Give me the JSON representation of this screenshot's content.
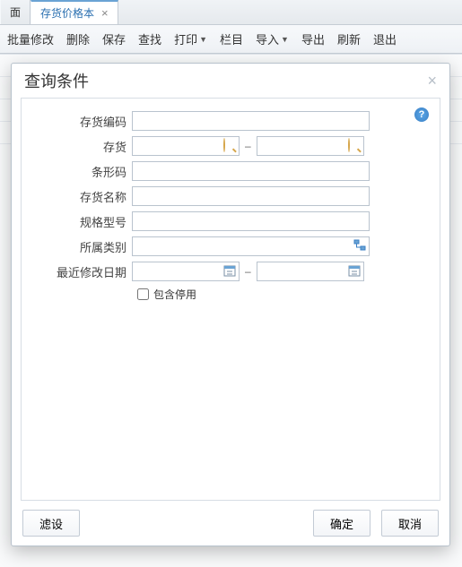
{
  "tabs": {
    "first": "面",
    "active": "存货价格本"
  },
  "toolbar": {
    "batch_edit": "批量修改",
    "delete": "删除",
    "save": "保存",
    "find": "查找",
    "print": "打印",
    "columns": "栏目",
    "import": "导入",
    "export": "导出",
    "refresh": "刷新",
    "exit": "退出"
  },
  "dialog": {
    "title": "查询条件",
    "help_char": "?",
    "labels": {
      "inv_code": "存货编码",
      "inventory": "存货",
      "barcode": "条形码",
      "inv_name": "存货名称",
      "spec": "规格型号",
      "category": "所属类别",
      "last_mod": "最近修改日期"
    },
    "dash": "–",
    "include_disabled": "包含停用",
    "buttons": {
      "filter": "滤设",
      "ok": "确定",
      "cancel": "取消"
    },
    "values": {
      "inv_code": "",
      "inventory_from": "",
      "inventory_to": "",
      "barcode": "",
      "inv_name": "",
      "spec": "",
      "category": "",
      "last_mod_from": "",
      "last_mod_to": ""
    }
  }
}
